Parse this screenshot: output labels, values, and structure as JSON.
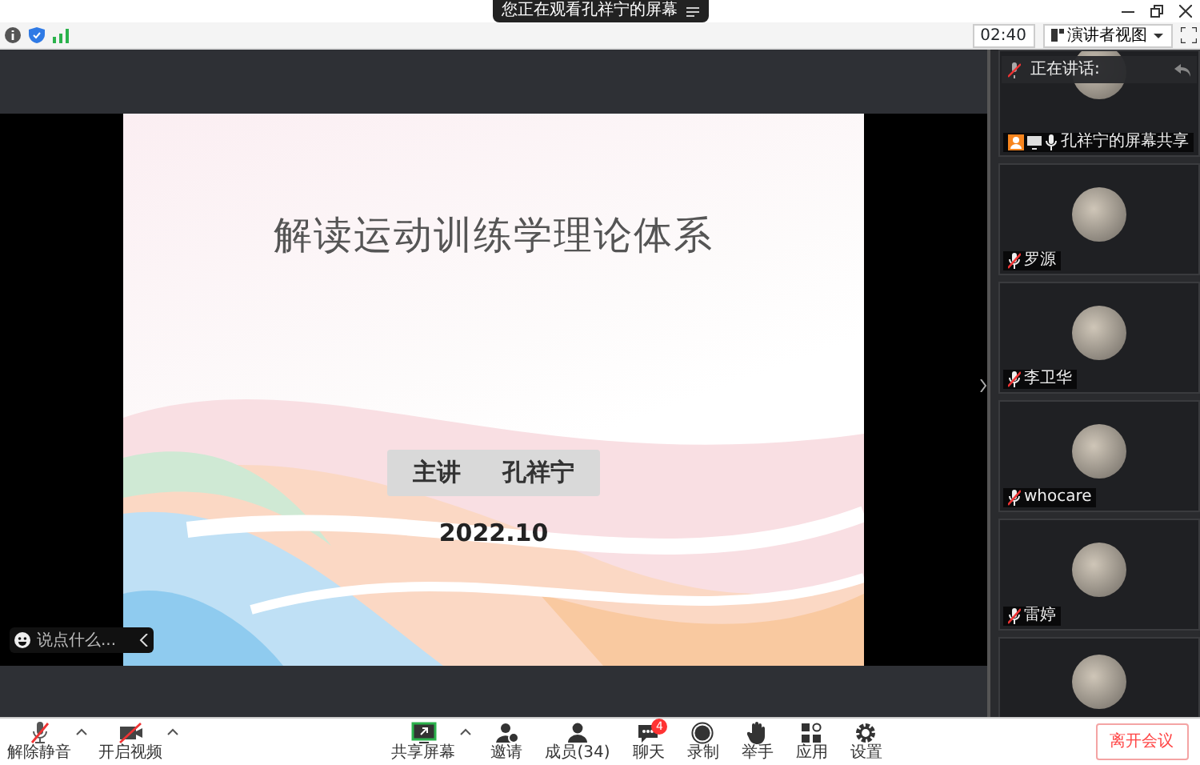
{
  "window": {
    "banner": "您正在观看孔祥宁的屏幕"
  },
  "toolbar": {
    "timer": "02:40",
    "view_label": "演讲者视图"
  },
  "slide": {
    "title": "解读运动训练学理论体系",
    "presenter_label": "主讲",
    "presenter": "孔祥宁",
    "date": "2022.10"
  },
  "chat_input": {
    "placeholder": "说点什么..."
  },
  "gallery": {
    "header": "正在讲话:",
    "tiles": [
      {
        "kind": "share",
        "label": "孔祥宁的屏幕共享",
        "muted": false
      },
      {
        "kind": "person",
        "label": "罗源",
        "muted": true
      },
      {
        "kind": "person",
        "label": "李卫华",
        "muted": true
      },
      {
        "kind": "person",
        "label": "whocare",
        "muted": true
      },
      {
        "kind": "person",
        "label": "雷婷",
        "muted": true
      },
      {
        "kind": "person"
      }
    ]
  },
  "controls_left": [
    {
      "kind": "mic",
      "label": "解除静音",
      "off": true,
      "menu": true
    },
    {
      "kind": "video",
      "label": "开启视频",
      "off": true,
      "menu": true
    }
  ],
  "controls_center": [
    {
      "kind": "share",
      "label": "共享屏幕",
      "menu": true
    },
    {
      "kind": "invite",
      "label": "邀请"
    },
    {
      "kind": "members",
      "label": "成员(34)"
    },
    {
      "kind": "chat",
      "label": "聊天",
      "badge": "4"
    },
    {
      "kind": "record",
      "label": "录制"
    },
    {
      "kind": "hand",
      "label": "举手"
    },
    {
      "kind": "apps",
      "label": "应用"
    },
    {
      "kind": "settings",
      "label": "设置"
    }
  ],
  "leave_button": "离开会议"
}
